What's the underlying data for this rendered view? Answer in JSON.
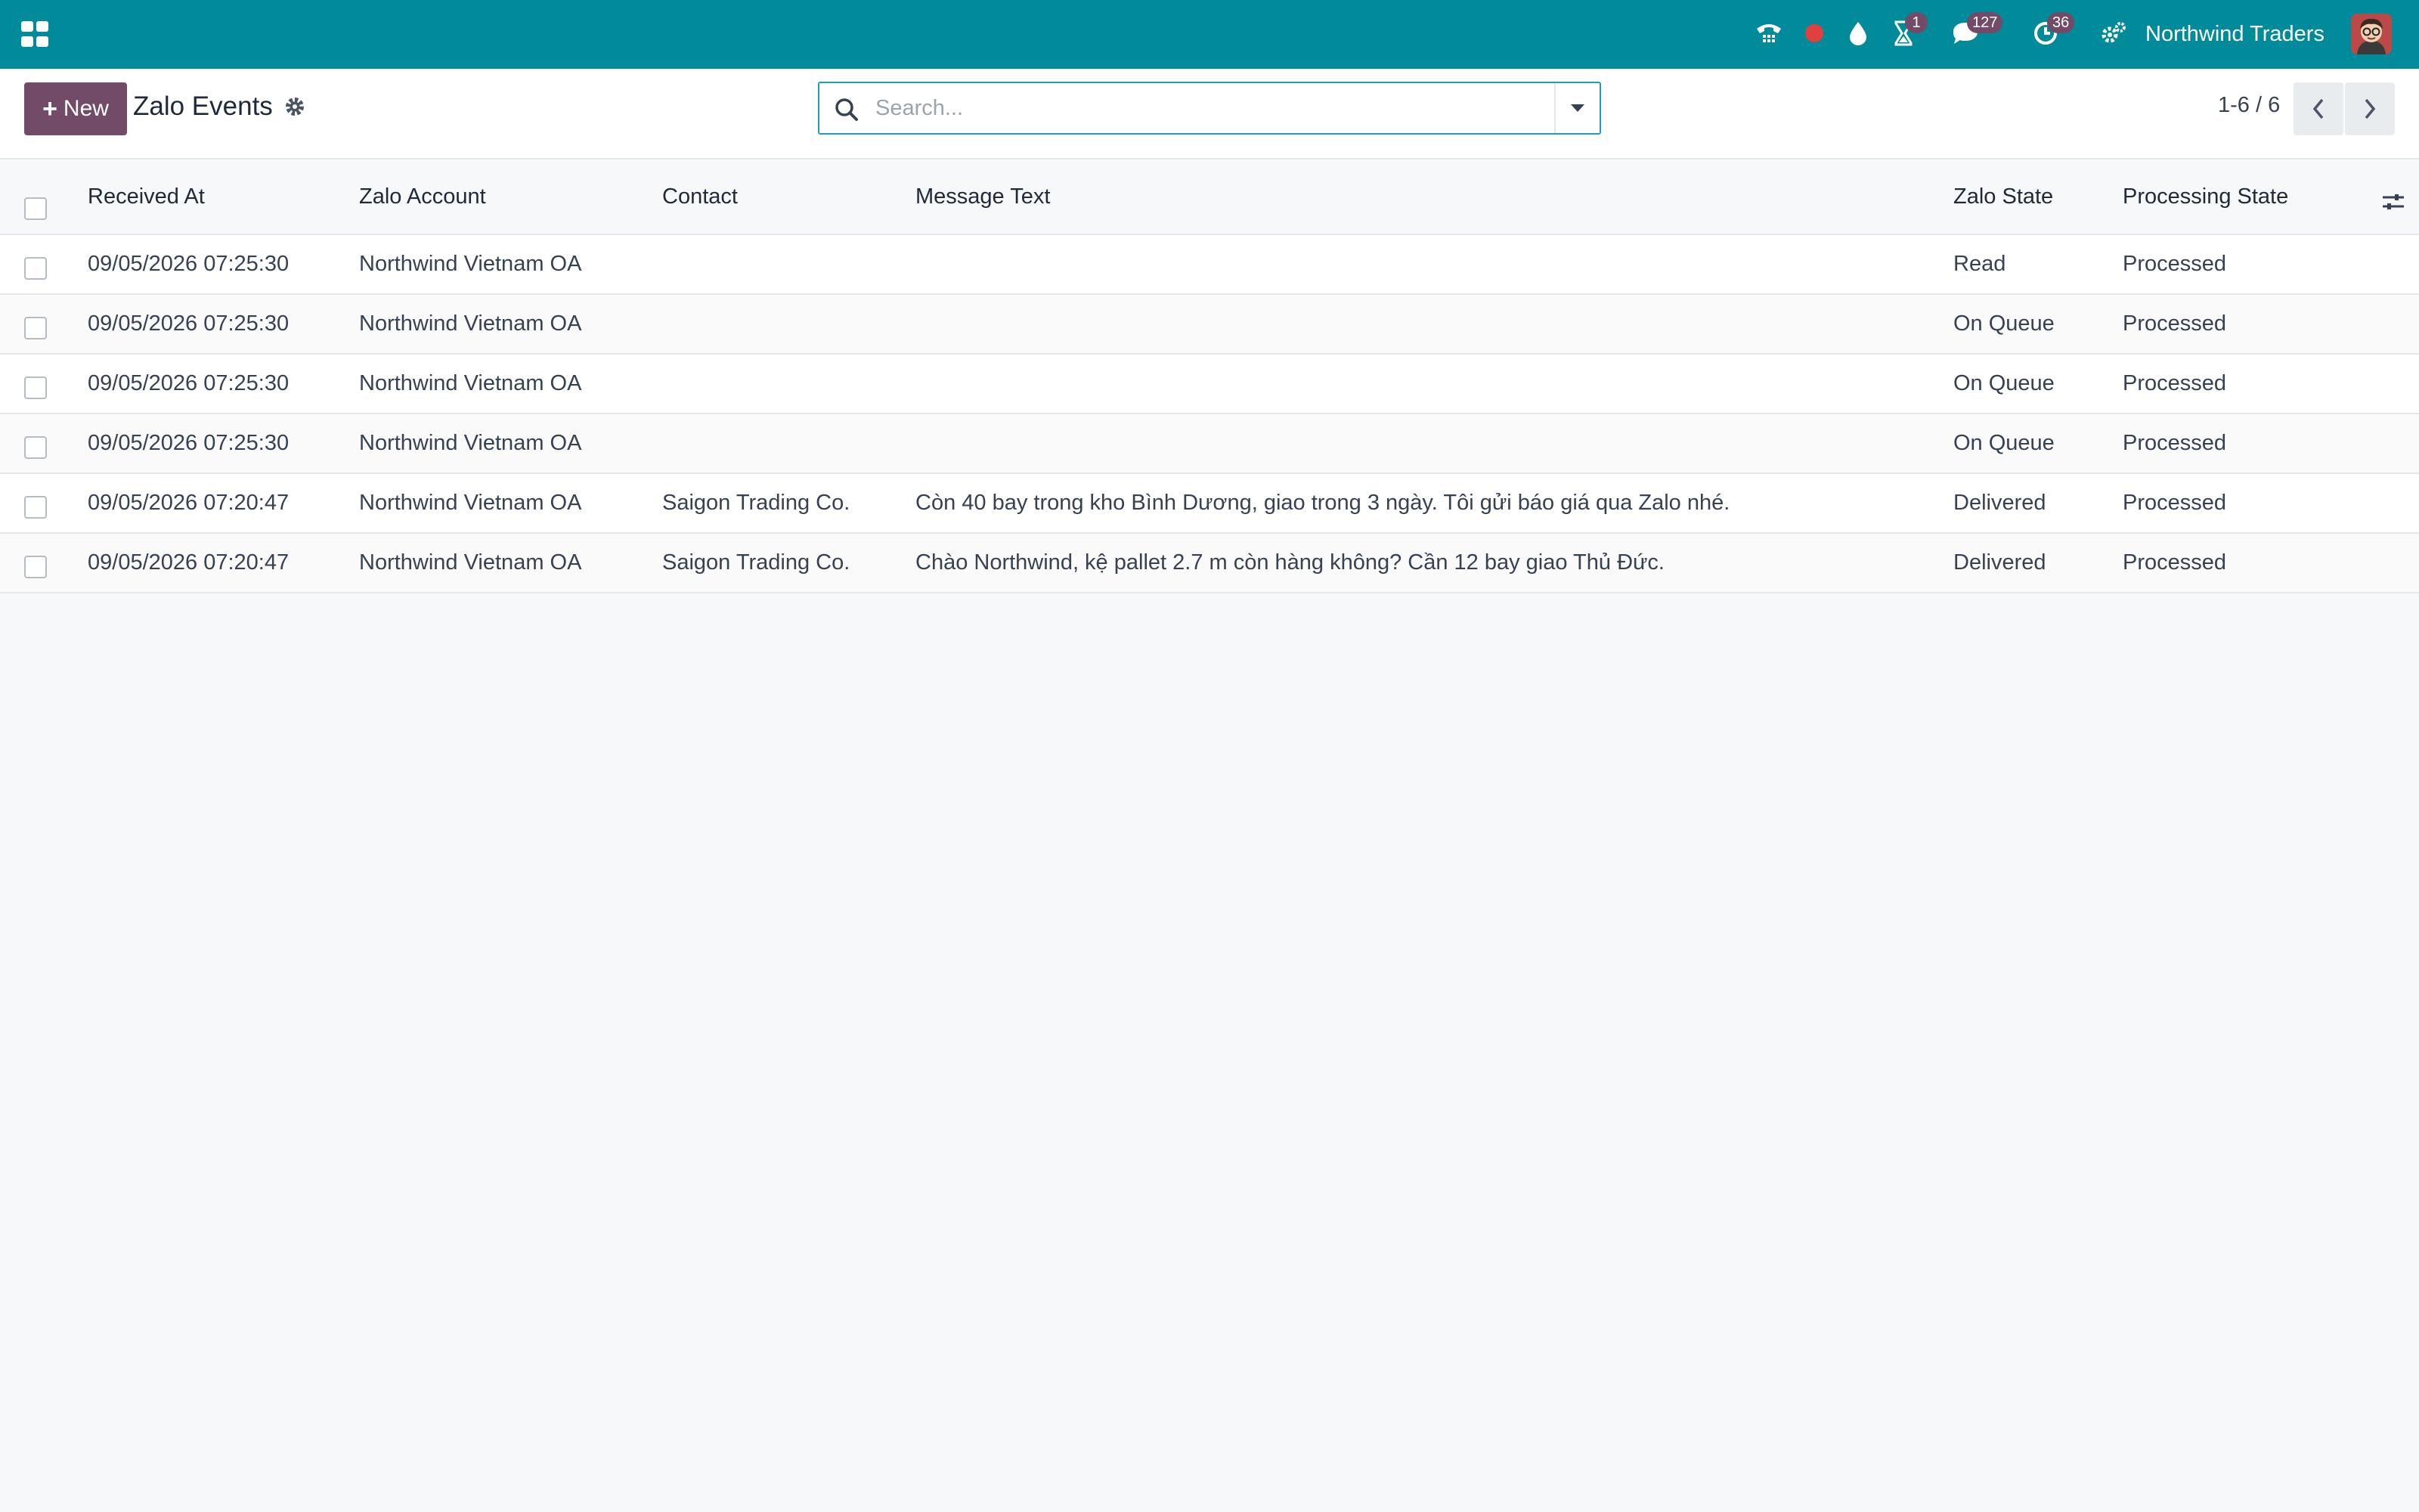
{
  "navbar": {
    "company": "Northwind Traders",
    "badges": {
      "activities_small": "1",
      "messages": "127",
      "activity": "36"
    }
  },
  "control_panel": {
    "new_label": "New",
    "title": "Zalo Events",
    "search_placeholder": "Search...",
    "pager": "1-6 / 6"
  },
  "table": {
    "columns": {
      "received_at": "Received At",
      "zalo_account": "Zalo Account",
      "contact": "Contact",
      "message_text": "Message Text",
      "zalo_state": "Zalo State",
      "processing_state": "Processing State"
    },
    "rows": [
      {
        "received_at": "09/05/2026 07:25:30",
        "zalo_account": "Northwind Vietnam OA",
        "contact": "",
        "message_text": "",
        "zalo_state": "Read",
        "processing_state": "Processed"
      },
      {
        "received_at": "09/05/2026 07:25:30",
        "zalo_account": "Northwind Vietnam OA",
        "contact": "",
        "message_text": "",
        "zalo_state": "On Queue",
        "processing_state": "Processed"
      },
      {
        "received_at": "09/05/2026 07:25:30",
        "zalo_account": "Northwind Vietnam OA",
        "contact": "",
        "message_text": "",
        "zalo_state": "On Queue",
        "processing_state": "Processed"
      },
      {
        "received_at": "09/05/2026 07:25:30",
        "zalo_account": "Northwind Vietnam OA",
        "contact": "",
        "message_text": "",
        "zalo_state": "On Queue",
        "processing_state": "Processed"
      },
      {
        "received_at": "09/05/2026 07:20:47",
        "zalo_account": "Northwind Vietnam OA",
        "contact": "Saigon Trading Co.",
        "message_text": "Còn 40 bay trong kho Bình Dương, giao trong 3 ngày. Tôi gửi báo giá qua Zalo nhé.",
        "zalo_state": "Delivered",
        "processing_state": "Processed"
      },
      {
        "received_at": "09/05/2026 07:20:47",
        "zalo_account": "Northwind Vietnam OA",
        "contact": "Saigon Trading Co.",
        "message_text": "Chào Northwind, kệ pallet 2.7 m còn hàng không? Cần 12 bay giao Thủ Đức.",
        "zalo_state": "Delivered",
        "processing_state": "Processed"
      }
    ]
  },
  "colors": {
    "navbar": "#018a9a",
    "primary": "#714b67",
    "search_border": "#17a2b8",
    "recording_dot": "#e0413f"
  },
  "icons": [
    "apps-grid-icon",
    "phone-icon",
    "recording-dot-icon",
    "drop-icon",
    "hourglass-icon",
    "chat-icon",
    "clock-icon",
    "settings-cogs-icon",
    "gear-icon",
    "search-icon",
    "caret-down-icon",
    "chevron-left-icon",
    "chevron-right-icon",
    "column-options-icon"
  ]
}
